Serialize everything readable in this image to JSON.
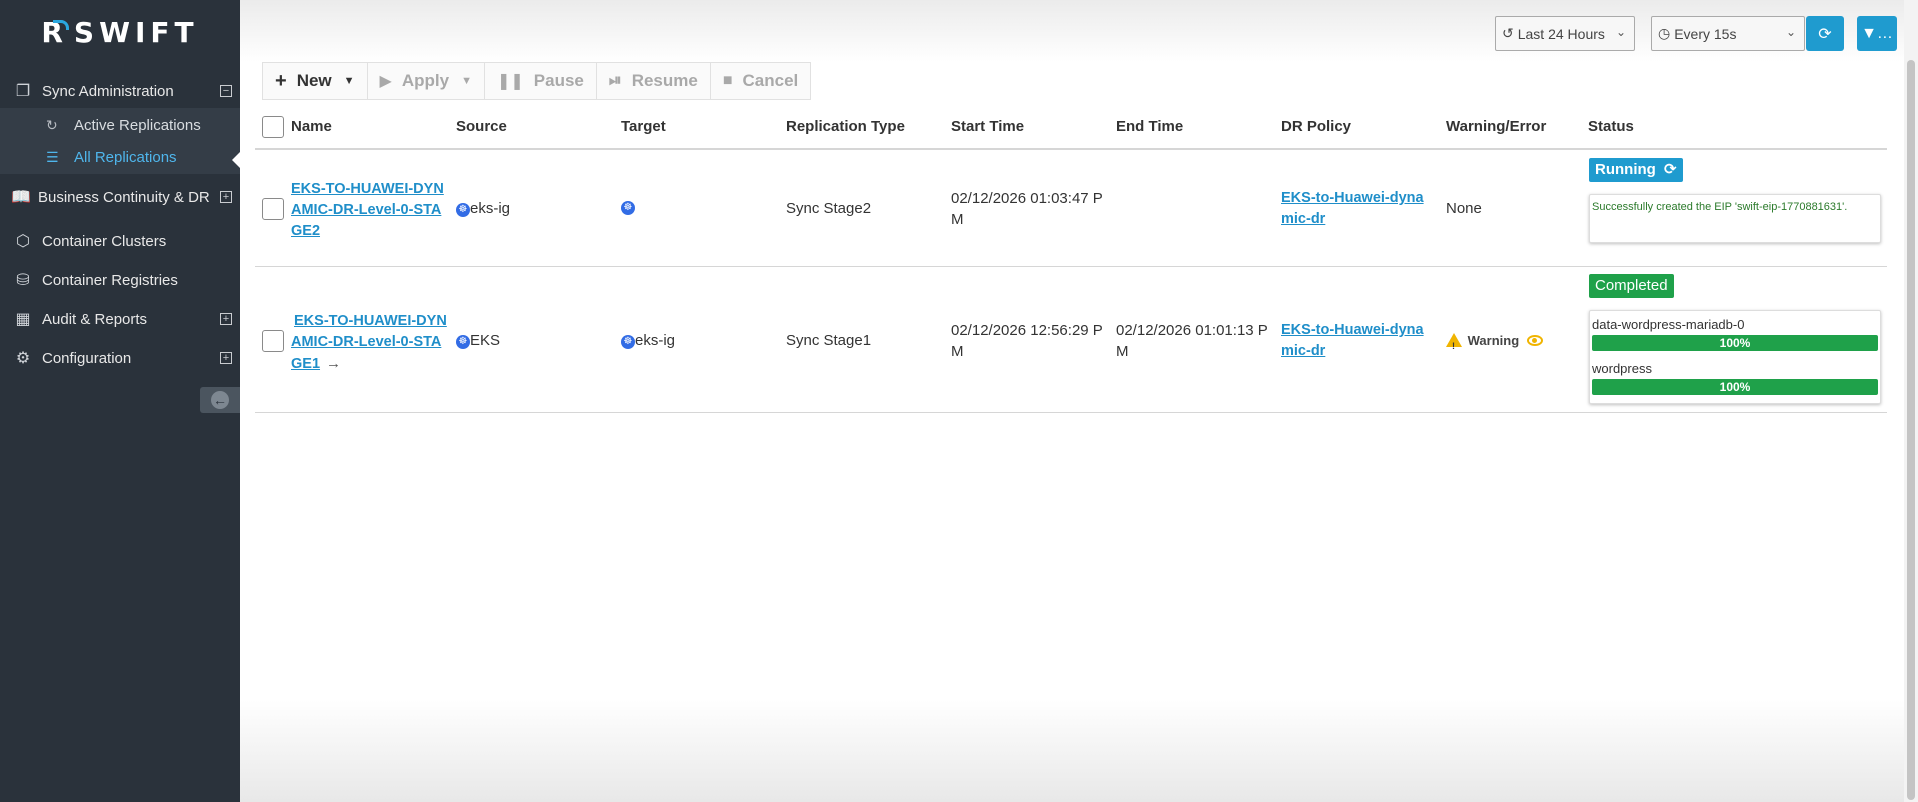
{
  "app": {
    "logo_text": "SWIFT"
  },
  "sidebar": {
    "items": [
      {
        "label": "Sync Administration",
        "icon": "copy-icon"
      },
      {
        "label": "Business Continuity & DR",
        "icon": "book-icon"
      },
      {
        "label": "Container Clusters",
        "icon": "cube-icon"
      },
      {
        "label": "Container Registries",
        "icon": "database-icon"
      },
      {
        "label": "Audit & Reports",
        "icon": "table-icon"
      },
      {
        "label": "Configuration",
        "icon": "gears-icon"
      }
    ],
    "subitems": [
      {
        "label": "Active Replications",
        "icon": "refresh-icon"
      },
      {
        "label": "All Replications",
        "icon": "list-icon",
        "active": true
      }
    ]
  },
  "topbar": {
    "time_range": "Last 24 Hours",
    "refresh_interval": "Every 15s"
  },
  "toolbar": {
    "new": "New",
    "apply": "Apply",
    "pause": "Pause",
    "resume": "Resume",
    "cancel": "Cancel"
  },
  "table": {
    "headers": [
      "Name",
      "Source",
      "Target",
      "Replication Type",
      "Start Time",
      "End Time",
      "DR Policy",
      "Warning/Error",
      "Status"
    ],
    "rows": [
      {
        "name": [
          "EKS-TO-HUAWEI-DYN",
          "AMIC-DR-Level-0-STA",
          "GE2"
        ],
        "source": "eks-ig",
        "target": "",
        "replication_type": "Sync Stage2",
        "start_time": [
          "02/12/2026 01:03:47 P",
          "M"
        ],
        "end_time": [
          "",
          ""
        ],
        "dr_policy": [
          "EKS-to-Huawei-dyna",
          "mic-dr"
        ],
        "warning": "None",
        "status": "Running",
        "status_message": "Successfully created the EIP 'swift-eip-1770881631'."
      },
      {
        "name": [
          "EKS-TO-HUAWEI-DYN",
          "AMIC-DR-Level-0-STA",
          "GE1"
        ],
        "source": "EKS",
        "target": "eks-ig",
        "replication_type": "Sync Stage1",
        "start_time": [
          "02/12/2026 12:56:29 P",
          "M"
        ],
        "end_time": [
          "02/12/2026 01:01:13 P",
          "M"
        ],
        "dr_policy": [
          "EKS-to-Huawei-dyna",
          "mic-dr"
        ],
        "warning": "Warning",
        "status": "Completed",
        "progress": [
          {
            "label": "data-wordpress-mariadb-0",
            "value": "100%",
            "fraction": 1.0
          },
          {
            "label": "wordpress",
            "value": "100%",
            "fraction": 1.0
          }
        ]
      }
    ]
  },
  "colors": {
    "sidebar_bg": "#2a323b",
    "accent": "#1f9bcf",
    "running": "#1f9bcf",
    "completed": "#1fa14a",
    "warning": "#f0b400",
    "link": "#1f8ec9"
  }
}
